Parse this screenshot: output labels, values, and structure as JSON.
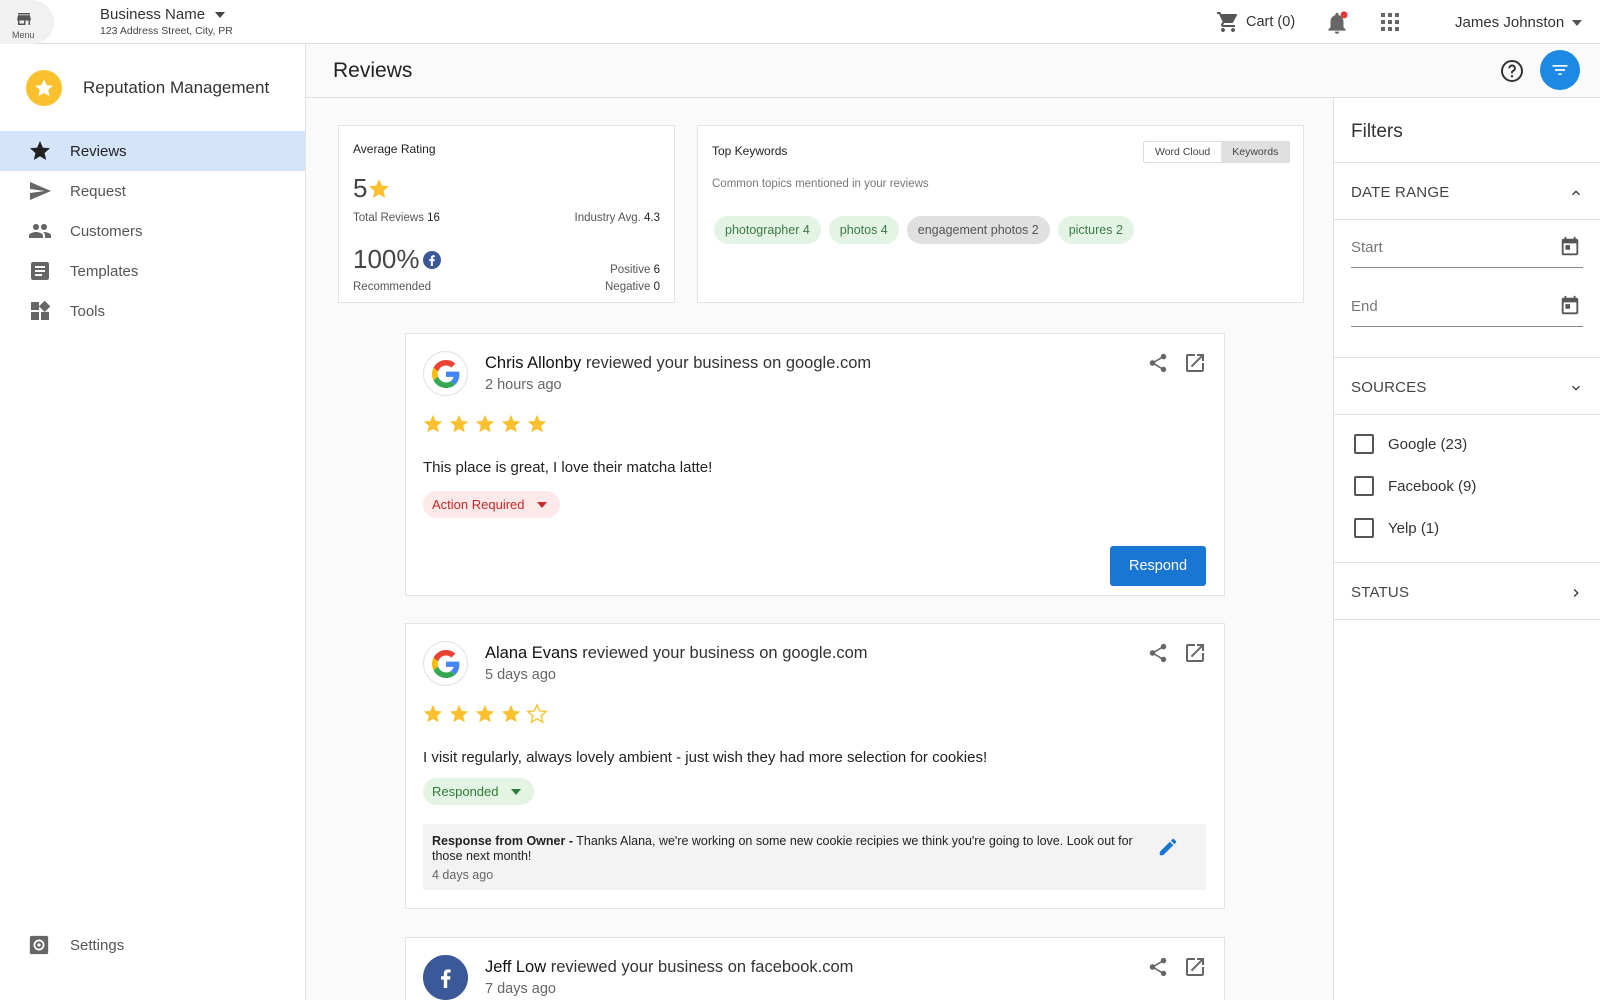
{
  "topbar": {
    "menu_label": "Menu",
    "business_name": "Business Name",
    "business_address": "123 Address Street, City, PR",
    "cart_label": "Cart (0)",
    "user_name": "James Johnston"
  },
  "sidebar": {
    "app_title": "Reputation Management",
    "items": [
      {
        "label": "Reviews",
        "icon": "star-icon",
        "active": true
      },
      {
        "label": "Request",
        "icon": "send-icon"
      },
      {
        "label": "Customers",
        "icon": "people-icon"
      },
      {
        "label": "Templates",
        "icon": "document-icon"
      },
      {
        "label": "Tools",
        "icon": "widgets-icon"
      }
    ],
    "settings_label": "Settings"
  },
  "page": {
    "title": "Reviews"
  },
  "average_rating": {
    "heading": "Average Rating",
    "rating": "5",
    "total_reviews_label": "Total Reviews",
    "total_reviews": "16",
    "industry_avg_label": "Industry Avg.",
    "industry_avg": "4.3",
    "recommended_pct": "100%",
    "recommended_label": "Recommended",
    "positive_label": "Positive",
    "positive": "6",
    "negative_label": "Negative",
    "negative": "0"
  },
  "keywords": {
    "heading": "Top Keywords",
    "subtitle": "Common topics mentioned in your reviews",
    "toggle": [
      "Word Cloud",
      "Keywords"
    ],
    "selected_toggle": "Keywords",
    "chips": [
      {
        "label": "photographer 4"
      },
      {
        "label": "photos 4"
      },
      {
        "label": "engagement photos 2"
      },
      {
        "label": "pictures 2"
      }
    ]
  },
  "reviews": [
    {
      "reviewer": "Chris Allonby",
      "action": "reviewed your business on google.com",
      "time": "2 hours ago",
      "source": "google",
      "stars": 5,
      "text": "This place is great, I love their matcha latte!",
      "status": "Action Required",
      "respond_label": "Respond"
    },
    {
      "reviewer": "Alana Evans",
      "action": "reviewed your business on google.com",
      "time": "5 days ago",
      "source": "google",
      "stars": 4,
      "text": "I visit regularly, always lovely ambient - just wish they had more selection for cookies!",
      "status": "Responded",
      "response_label": "Response from Owner -",
      "response_text": "Thanks Alana, we're working on some new cookie recipies we think you're going to love. Look out for those next month!",
      "response_time": "4 days ago"
    },
    {
      "reviewer": "Jeff Low",
      "action": "reviewed your business on facebook.com",
      "time": "7 days ago",
      "source": "facebook"
    }
  ],
  "filters": {
    "title": "Filters",
    "date_range_label": "DATE RANGE",
    "start_label": "Start",
    "end_label": "End",
    "sources_label": "SOURCES",
    "sources": [
      {
        "label": "Google (23)",
        "checked": false
      },
      {
        "label": "Facebook (9)",
        "checked": false
      },
      {
        "label": "Yelp (1)",
        "checked": false
      }
    ],
    "status_label": "STATUS"
  },
  "colors": {
    "accent": "#1976d2",
    "star": "#fbc02d",
    "active_nav": "#d3e4fb",
    "action_required": "#c62828",
    "responded": "#2e7d32"
  }
}
